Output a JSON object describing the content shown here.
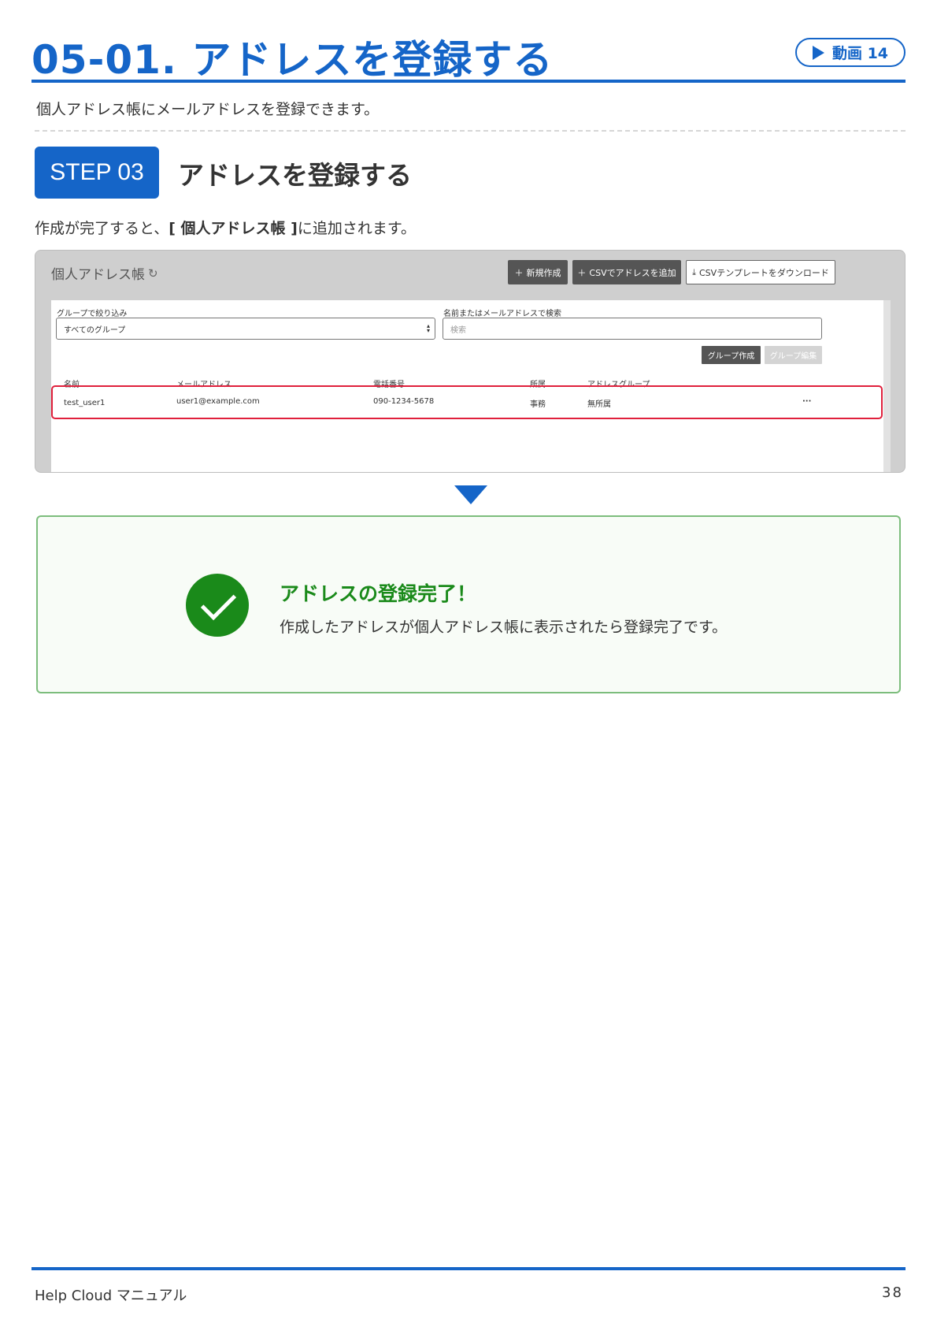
{
  "header": {
    "title": "05-01. アドレスを登録する",
    "video_label": "動画 14"
  },
  "intro": "個人アドレス帳にメールアドレスを登録できます。",
  "step": {
    "badge": "STEP 03",
    "title": "アドレスを登録する",
    "desc_before": "作成が完了すると、",
    "desc_bold": "[ 個人アドレス帳 ]",
    "desc_after": "に追加されます。"
  },
  "screenshot": {
    "title": "個人アドレス帳",
    "buttons": {
      "new": "新規作成",
      "csv_add": "CSVでアドレスを追加",
      "csv_template": "CSVテンプレートをダウンロード",
      "group_create": "グループ作成",
      "group_edit": "グループ編集"
    },
    "filter_label": "グループで絞り込み",
    "filter_value": "すべてのグループ",
    "search_label": "名前またはメールアドレスで検索",
    "search_placeholder": "検索",
    "columns": [
      "名前",
      "メールアドレス",
      "電話番号",
      "所属",
      "アドレスグループ"
    ],
    "row": {
      "name": "test_user1",
      "email": "user1@example.com",
      "phone": "090-1234-5678",
      "dept": "事務",
      "group": "無所属",
      "more": "···"
    }
  },
  "result": {
    "title": "アドレスの登録完了！",
    "text": "作成したアドレスが個人アドレス帳に表示されたら登録完了です。"
  },
  "footer": {
    "left": "Help Cloud マニュアル",
    "page": "38"
  },
  "colors": {
    "primary": "#1565c8",
    "success": "#1a8a1a",
    "highlight": "#e0203c"
  }
}
